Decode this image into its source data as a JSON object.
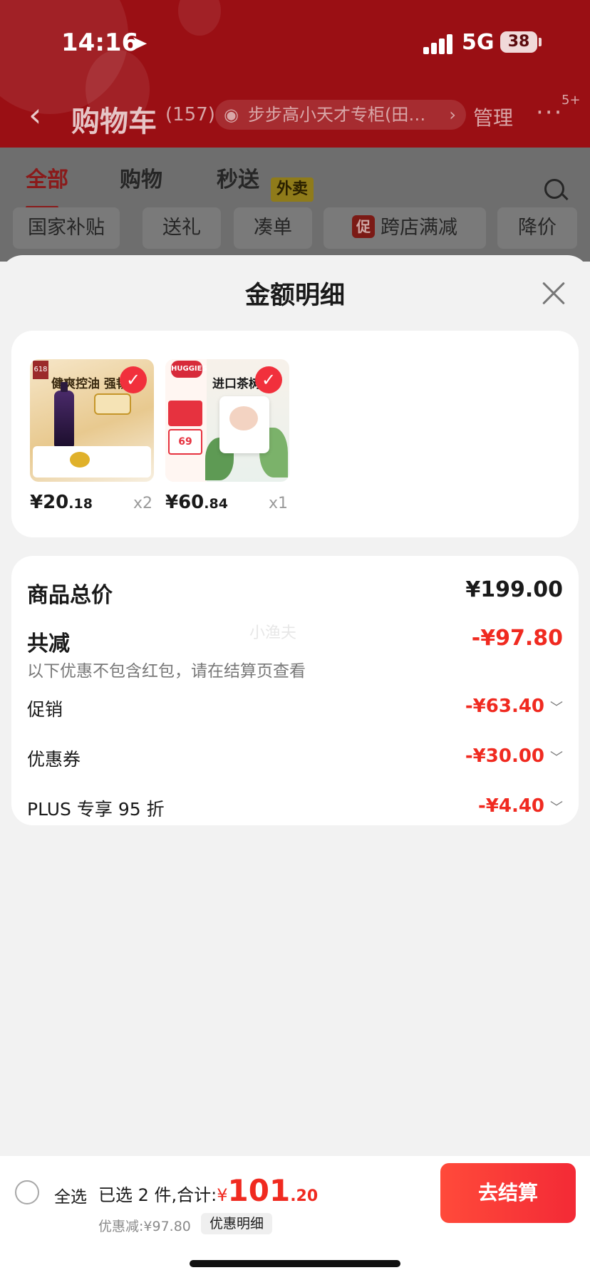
{
  "status_bar": {
    "time": "14:16",
    "network": "5G",
    "battery": "38"
  },
  "nav": {
    "title": "购物车",
    "count": "(157)",
    "store": "步步高小天才专柜(田…",
    "manage": "管理",
    "badge": "5+"
  },
  "tabs": [
    {
      "label": "全部"
    },
    {
      "label": "购物"
    },
    {
      "label": "秒送"
    }
  ],
  "tab_tag": "外卖",
  "chips": [
    "国家补贴",
    "送礼",
    "凑单",
    "跨店满减",
    "降价"
  ],
  "chip_promo_badge": "促",
  "sheet": {
    "title": "金额明细",
    "products": [
      {
        "price_int": "¥20",
        "price_dec": ".18",
        "qty": "x2",
        "image_text": "健爽控油 强韧防",
        "image_tag": "618"
      },
      {
        "price_int": "¥60",
        "price_dec": ".84",
        "qty": "x1",
        "image_text": "进口茶树",
        "image_logo": "HUGGIES",
        "image_price": "69"
      }
    ],
    "summary": {
      "total_label": "商品总价",
      "total_value": "¥199.00",
      "watermark": "小渔夫",
      "reduce_label": "共减",
      "reduce_value": "-¥97.80",
      "note": "以下优惠不包含红包，请在结算页查看",
      "items": [
        {
          "label": "促销",
          "value": "-¥63.40"
        },
        {
          "label": "优惠券",
          "value": "-¥30.00"
        },
        {
          "label": "PLUS 专享 95 折",
          "value": "-¥4.40"
        }
      ]
    }
  },
  "bottom": {
    "select_all": "全选",
    "selected_text": "已选 2 件,合计:",
    "yen": "¥",
    "total_int": "101",
    "total_dec": ".20",
    "discount": "优惠减:¥97.80",
    "detail_chip": "优惠明细",
    "checkout": "去结算"
  },
  "colors": {
    "accent_red": "#f02a20",
    "header_bg": "#9a0f14",
    "checkout": "#f32a36"
  }
}
